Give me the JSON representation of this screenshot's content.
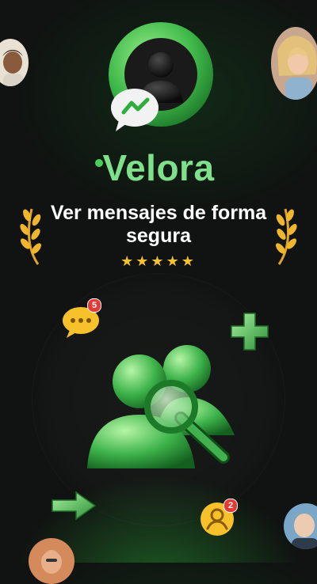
{
  "app": {
    "name": "Velora"
  },
  "headline": "Ver mensajes de forma segura",
  "rating": {
    "stars": 5,
    "display": "★★★★★"
  },
  "badges": {
    "chat_count": "5",
    "contact_count": "2"
  },
  "colors": {
    "brand_green": "#7ee08a",
    "accent_green": "#4ccf5a",
    "star": "#f6c12b",
    "badge_red": "#e53935",
    "background": "#101311"
  },
  "icons": [
    "user-magnifier-logo-icon",
    "chat-bubble-icon",
    "laurel-icon",
    "plus-icon",
    "arrow-right-icon",
    "user-group-search-icon",
    "user-icon"
  ]
}
